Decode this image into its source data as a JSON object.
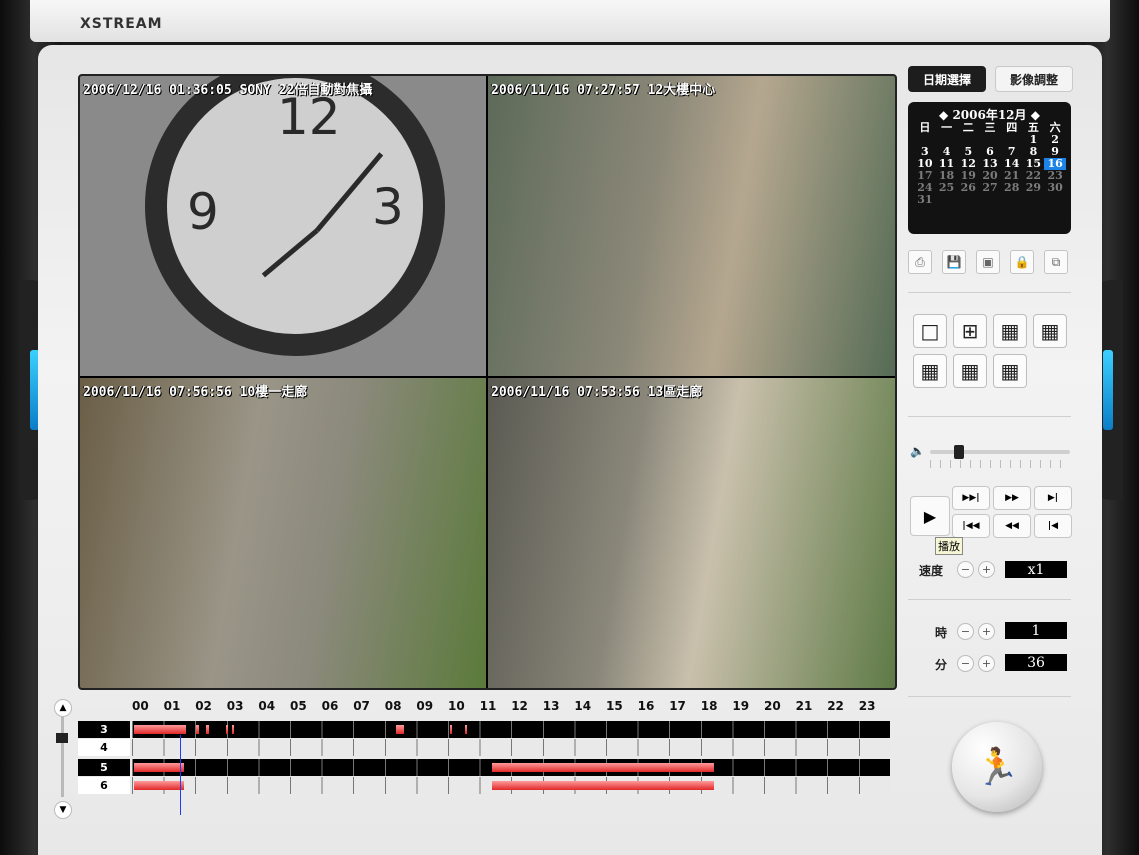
{
  "app": {
    "brand": "XSTREAM"
  },
  "cameras": [
    {
      "timestamp": "2006/12/16 01:36:05 SONY 22倍自動對焦攝"
    },
    {
      "timestamp": "2006/11/16 07:27:57 12大樓中心"
    },
    {
      "timestamp": "2006/11/16 07:56:56 10樓一走廊"
    },
    {
      "timestamp": "2006/11/16 07:53:56 13區走廊"
    }
  ],
  "tabs": {
    "date_select": "日期選擇",
    "image_adjust": "影像調整"
  },
  "calendar": {
    "header": "◆ 2006年12月 ◆",
    "weekdays": [
      "日",
      "一",
      "二",
      "三",
      "四",
      "五",
      "六"
    ],
    "rows": [
      [
        "",
        "",
        "",
        "",
        "",
        "1",
        "2"
      ],
      [
        "3",
        "4",
        "5",
        "6",
        "7",
        "8",
        "9"
      ],
      [
        "10",
        "11",
        "12",
        "13",
        "14",
        "15",
        "16"
      ],
      [
        "17",
        "18",
        "19",
        "20",
        "21",
        "22",
        "23"
      ],
      [
        "24",
        "25",
        "26",
        "27",
        "28",
        "29",
        "30"
      ],
      [
        "31",
        "",
        "",
        "",
        "",
        "",
        ""
      ]
    ],
    "selected": "16"
  },
  "toolbar_icons": [
    "print-icon",
    "save-icon",
    "snapshot-icon",
    "lock-icon",
    "copy-icon"
  ],
  "playback": {
    "tooltip": "播放",
    "speed_label": "速度",
    "speed_value": "x1"
  },
  "time": {
    "hour_label": "時",
    "hour_value": "1",
    "minute_label": "分",
    "minute_value": "36"
  },
  "timeline": {
    "hours": [
      "00",
      "01",
      "02",
      "03",
      "04",
      "05",
      "06",
      "07",
      "08",
      "09",
      "10",
      "11",
      "12",
      "13",
      "14",
      "15",
      "16",
      "17",
      "18",
      "19",
      "20",
      "21",
      "22",
      "23"
    ],
    "channels": [
      "3",
      "4",
      "5",
      "6"
    ]
  }
}
